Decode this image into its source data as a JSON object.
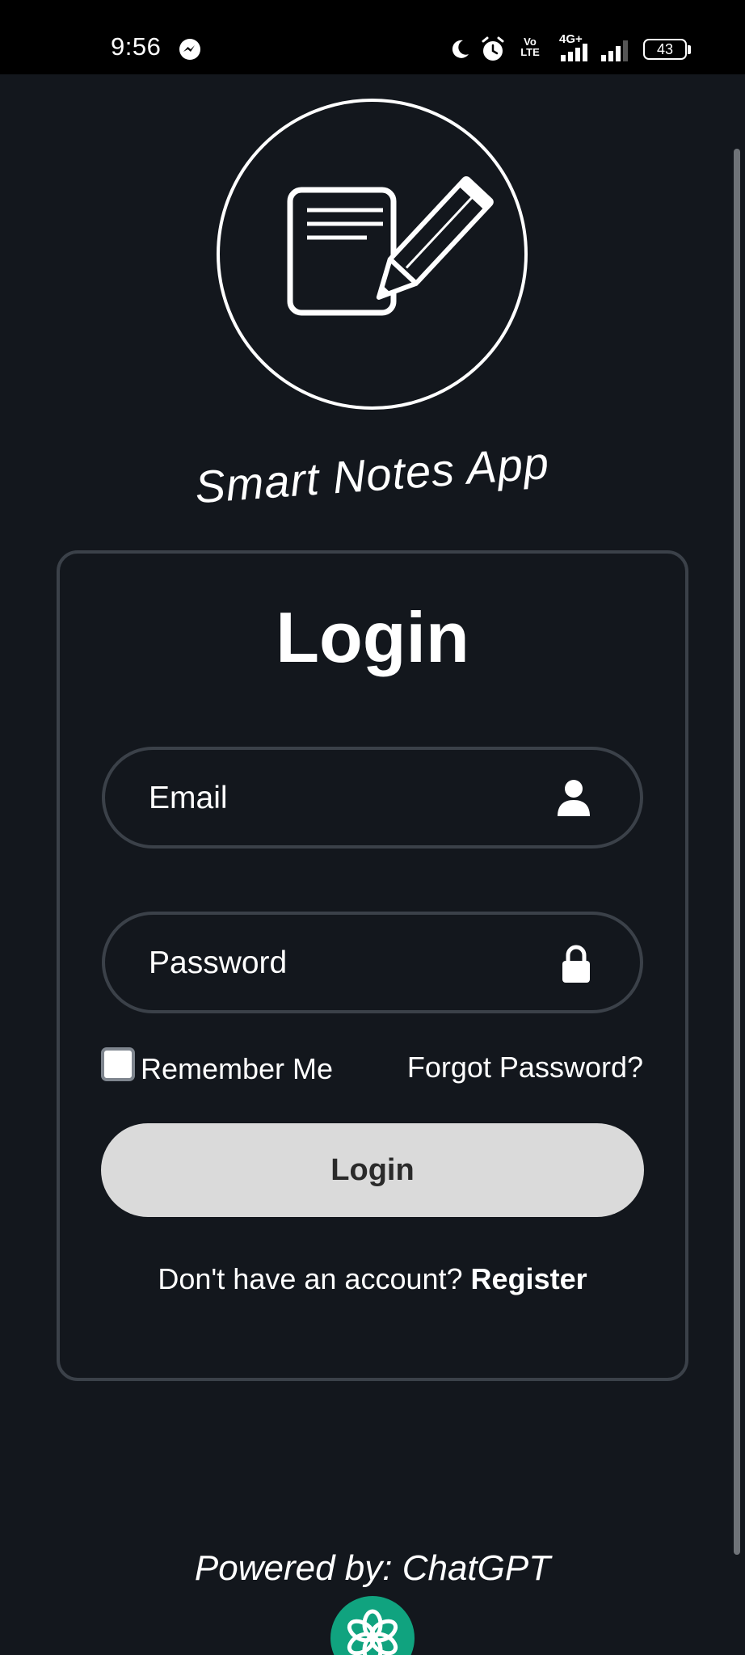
{
  "status_bar": {
    "time": "9:56",
    "volte_label": "Vo LTE",
    "network_label": "4G+",
    "battery_level": "43"
  },
  "app": {
    "title": "Smart Notes App",
    "logo_icon": "notepad-pencil-icon"
  },
  "login_form": {
    "heading": "Login",
    "email_placeholder": "Email",
    "email_icon": "user-icon",
    "password_placeholder": "Password",
    "password_icon": "lock-icon",
    "remember_me_label": "Remember Me",
    "remember_me_checked": false,
    "forgot_password_label": "Forgot Password?",
    "submit_label": "Login",
    "register_prompt": "Don't have an account?",
    "register_label": "Register"
  },
  "footer": {
    "powered_by": "Powered by: ChatGPT",
    "logo_icon": "openai-icon",
    "logo_color": "#10a37f"
  },
  "colors": {
    "background": "#13171d",
    "card_border": "#3b4149",
    "button_bg": "#dadada",
    "text": "#ffffff"
  }
}
